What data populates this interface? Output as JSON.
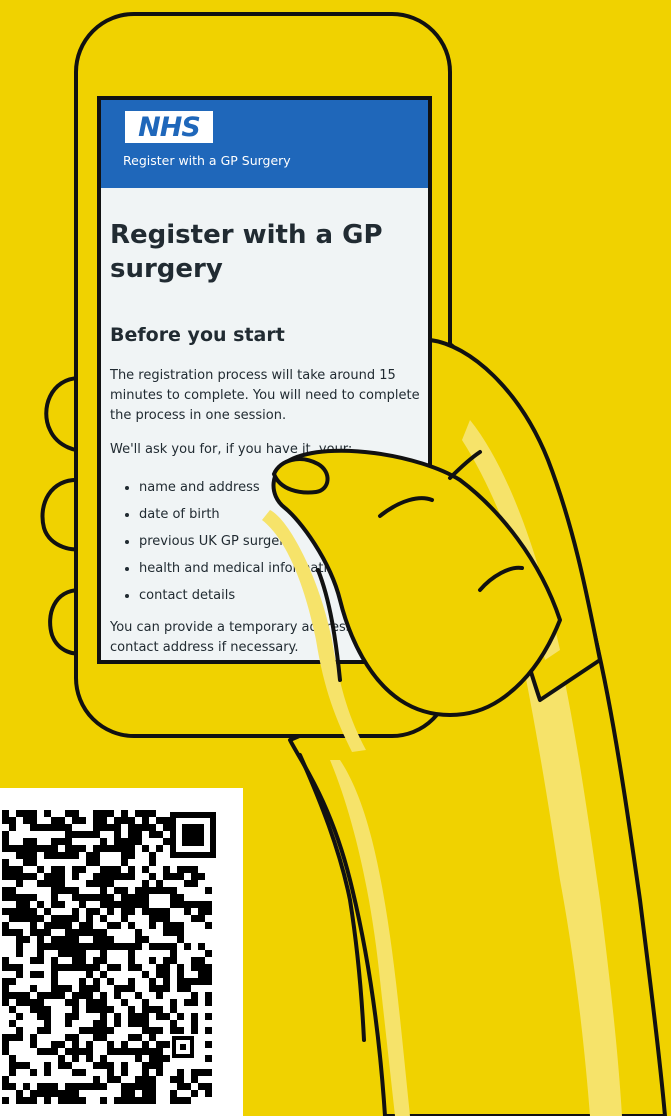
{
  "phone_screen": {
    "header": {
      "logo_text": "NHS",
      "service_name": "Register with a GP Surgery"
    },
    "page_title": "Register with a GP surgery",
    "section_heading": "Before you start",
    "intro_lines": [
      "The registration process will take around 15",
      "minutes to complete. You will need to complete",
      "the process in one session."
    ],
    "ask_line": "We'll ask you for, if you have it, your:",
    "list_items": [
      "name and address",
      "date of birth",
      "previous UK GP surgery",
      "health and medical information",
      "contact details"
    ],
    "temp_address_lines": [
      "You can provide a temporary address or",
      "contact address if necessary."
    ]
  },
  "colors": {
    "background": "#F0D200",
    "nhs_blue": "#1F67BA",
    "screen_bg": "#F0F4F5",
    "text": "#212B32",
    "hand_fill": "#F0D200",
    "hand_highlight": "#F6E36A",
    "outline": "#111111"
  },
  "icons": {
    "qr_code": "qr-code-icon",
    "phone": "smartphone-illustration",
    "hand": "hand-illustration"
  }
}
